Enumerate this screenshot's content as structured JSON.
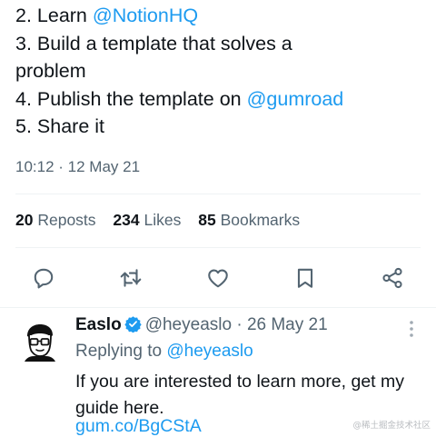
{
  "tweet": {
    "lines": [
      [
        {
          "text": "2. Learn "
        },
        {
          "text": "@NotionHQ",
          "mention": true
        }
      ],
      [
        {
          "text": "3. Build a template that solves a"
        }
      ],
      [
        {
          "text": "problem"
        }
      ],
      [
        {
          "text": "4. Publish the template on "
        },
        {
          "text": "@gumroad",
          "mention": true
        }
      ],
      [
        {
          "text": "5. Share it"
        }
      ]
    ],
    "timestamp": "10:12 · 12 May 21"
  },
  "stats": {
    "reposts_count": "20",
    "reposts_label": "Reposts",
    "likes_count": "234",
    "likes_label": "Likes",
    "bookmarks_count": "85",
    "bookmarks_label": "Bookmarks"
  },
  "actions": [
    {
      "name": "reply-icon"
    },
    {
      "name": "repost-icon"
    },
    {
      "name": "like-icon"
    },
    {
      "name": "bookmark-icon"
    },
    {
      "name": "share-icon"
    }
  ],
  "reply": {
    "author_name": "Easlo",
    "author_handle": "@heyeaslo",
    "date_separator": "·",
    "date": "26 May 21",
    "replying_prefix": "Replying to",
    "replying_handle": "@heyeaslo",
    "text": "If you are interested to learn more, get my guide here.",
    "link": "gum.co/BgCStA",
    "verified_icon": "verified-badge-icon",
    "more_icon": "more-vertical-icon"
  },
  "watermark": "@稀土掘金技术社区",
  "colors": {
    "accent": "#1d9bf0",
    "secondary_text": "#536471",
    "divider": "#eff3f4"
  }
}
